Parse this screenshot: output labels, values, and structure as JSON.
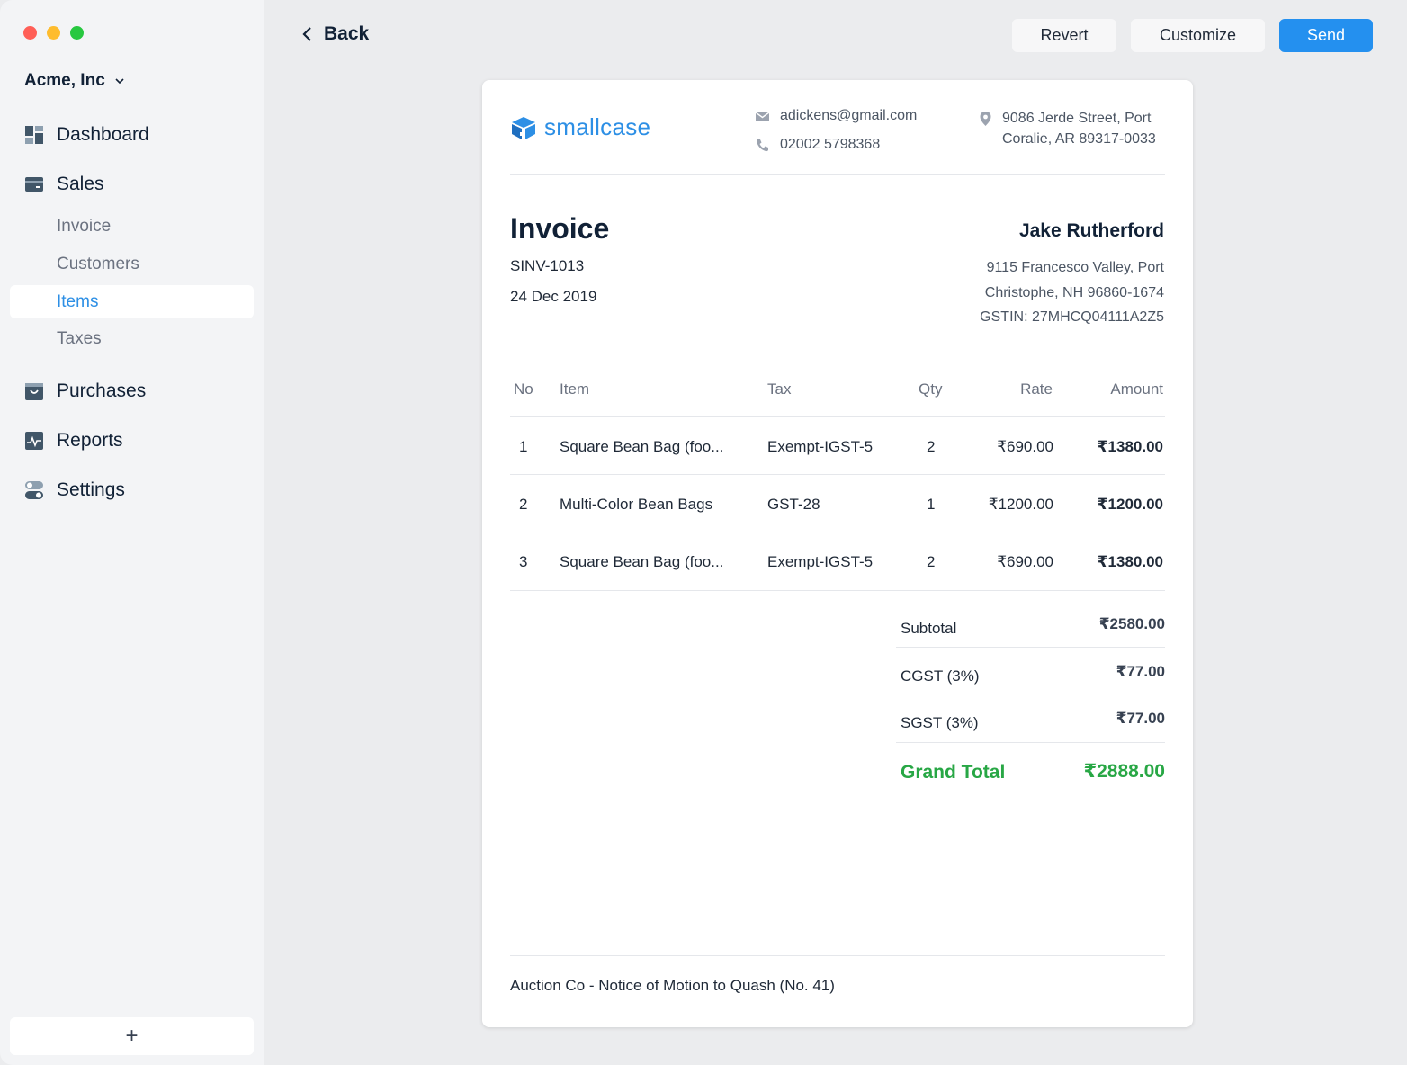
{
  "window": {
    "traffic_lights": [
      "close",
      "minimize",
      "zoom"
    ]
  },
  "sidebar": {
    "company": "Acme, Inc",
    "nav": [
      {
        "label": "Dashboard",
        "icon": "dashboard-icon"
      },
      {
        "label": "Sales",
        "icon": "sales-card-icon"
      },
      {
        "label": "Purchases",
        "icon": "purchases-bag-icon"
      },
      {
        "label": "Reports",
        "icon": "reports-chart-icon"
      },
      {
        "label": "Settings",
        "icon": "settings-toggle-icon"
      }
    ],
    "sales_sub": [
      {
        "label": "Invoice",
        "active": false
      },
      {
        "label": "Customers",
        "active": false
      },
      {
        "label": "Items",
        "active": true
      },
      {
        "label": "Taxes",
        "active": false
      }
    ],
    "add_label": "+"
  },
  "toolbar": {
    "back_label": "Back",
    "revert_label": "Revert",
    "customize_label": "Customize",
    "send_label": "Send"
  },
  "invoice": {
    "brand": "smallcase",
    "email": "adickens@gmail.com",
    "phone": "02002 5798368",
    "address_line1": "9086 Jerde Street, Port",
    "address_line2": "Coralie, AR 89317-0033",
    "title": "Invoice",
    "number": "SINV-1013",
    "date": "24 Dec 2019",
    "customer": {
      "name": "Jake Rutherford",
      "line1": "9115 Francesco Valley, Port",
      "line2": "Christophe, NH 96860-1674",
      "gstin": "GSTIN: 27MHCQ04111A2Z5"
    },
    "columns": {
      "no": "No",
      "item": "Item",
      "tax": "Tax",
      "qty": "Qty",
      "rate": "Rate",
      "amount": "Amount"
    },
    "rows": [
      {
        "no": "1",
        "item": "Square Bean Bag (foo...",
        "tax": "Exempt-IGST-5",
        "qty": "2",
        "rate": "₹690.00",
        "amount": "₹1380.00"
      },
      {
        "no": "2",
        "item": "Multi-Color Bean Bags",
        "tax": "GST-28",
        "qty": "1",
        "rate": "₹1200.00",
        "amount": "₹1200.00"
      },
      {
        "no": "3",
        "item": "Square Bean Bag (foo...",
        "tax": "Exempt-IGST-5",
        "qty": "2",
        "rate": "₹690.00",
        "amount": "₹1380.00"
      }
    ],
    "totals": {
      "subtotal_label": "Subtotal",
      "subtotal": "₹2580.00",
      "cgst_label": "CGST (3%)",
      "cgst": "₹77.00",
      "sgst_label": "SGST (3%)",
      "sgst": "₹77.00",
      "grand_label": "Grand Total",
      "grand": "₹2888.00"
    },
    "footer_note": "Auction Co - Notice of Motion to Quash (No. 41)"
  },
  "colors": {
    "accent": "#2490ef",
    "brand": "#2d8fe5",
    "grand_total": "#28a745"
  }
}
